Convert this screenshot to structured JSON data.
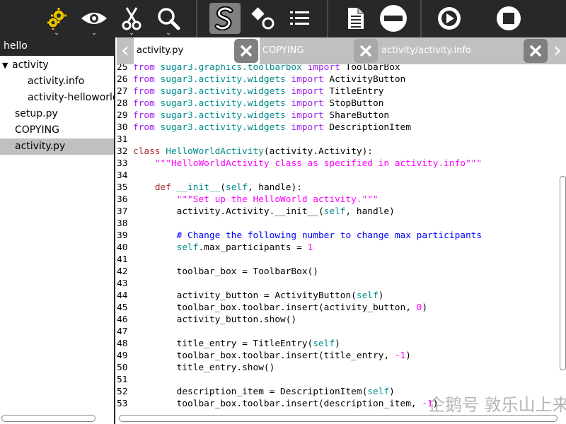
{
  "toolbar": {
    "buttons": [
      {
        "name": "activity-icon",
        "has_dropdown": true
      },
      {
        "name": "view-icon",
        "has_dropdown": true
      },
      {
        "name": "edit-scissors-icon",
        "has_dropdown": true
      },
      {
        "name": "search-icon",
        "has_dropdown": true
      },
      {
        "name": "symbol-s-icon",
        "active": true
      },
      {
        "name": "shapes-icon"
      },
      {
        "name": "list-icon"
      },
      {
        "name": "document-icon"
      },
      {
        "name": "minus-circle-icon"
      },
      {
        "name": "play-icon"
      },
      {
        "name": "stop-icon"
      }
    ],
    "dropdown_glyph": "⌄"
  },
  "sidebar": {
    "header": "hello",
    "items": [
      {
        "label": "activity",
        "expanded": true,
        "level": 0
      },
      {
        "label": "activity.info",
        "level": 1
      },
      {
        "label": "activity-helloworld",
        "level": 1
      },
      {
        "label": "setup.py",
        "level": 0
      },
      {
        "label": "COPYING",
        "level": 0
      },
      {
        "label": "activity.py",
        "level": 0,
        "selected": true
      }
    ]
  },
  "tabs": [
    {
      "label": "activity.py",
      "active": true
    },
    {
      "label": "COPYING",
      "active": false
    },
    {
      "label": "activity/activity.info",
      "active": false
    }
  ],
  "nav": {
    "prev": "‹",
    "next": "›"
  },
  "editor": {
    "lines": [
      {
        "n": "25",
        "t": [
          [
            "kw2",
            "from "
          ],
          [
            "mod",
            "sugar3.graphics.toolbarbox "
          ],
          [
            "kw2",
            "import "
          ],
          [
            "",
            "ToolbarBox"
          ]
        ]
      },
      {
        "n": "26",
        "t": [
          [
            "kw2",
            "from "
          ],
          [
            "mod",
            "sugar3.activity.widgets "
          ],
          [
            "kw2",
            "import "
          ],
          [
            "",
            "ActivityButton"
          ]
        ]
      },
      {
        "n": "27",
        "t": [
          [
            "kw2",
            "from "
          ],
          [
            "mod",
            "sugar3.activity.widgets "
          ],
          [
            "kw2",
            "import "
          ],
          [
            "",
            "TitleEntry"
          ]
        ]
      },
      {
        "n": "28",
        "t": [
          [
            "kw2",
            "from "
          ],
          [
            "mod",
            "sugar3.activity.widgets "
          ],
          [
            "kw2",
            "import "
          ],
          [
            "",
            "StopButton"
          ]
        ]
      },
      {
        "n": "29",
        "t": [
          [
            "kw2",
            "from "
          ],
          [
            "mod",
            "sugar3.activity.widgets "
          ],
          [
            "kw2",
            "import "
          ],
          [
            "",
            "ShareButton"
          ]
        ]
      },
      {
        "n": "30",
        "t": [
          [
            "kw2",
            "from "
          ],
          [
            "mod",
            "sugar3.activity.widgets "
          ],
          [
            "kw2",
            "import "
          ],
          [
            "",
            "DescriptionItem"
          ]
        ]
      },
      {
        "n": "31",
        "t": []
      },
      {
        "n": "32",
        "t": [
          [
            "kw",
            "class "
          ],
          [
            "cls",
            "HelloWorldActivity"
          ],
          [
            "",
            "(activity.Activity):"
          ]
        ]
      },
      {
        "n": "33",
        "t": [
          [
            "",
            "    "
          ],
          [
            "str",
            "\"\"\"HelloWorldActivity class as specified in activity.info\"\"\""
          ]
        ]
      },
      {
        "n": "34",
        "t": []
      },
      {
        "n": "35",
        "t": [
          [
            "",
            "    "
          ],
          [
            "kw",
            "def "
          ],
          [
            "cls",
            "__init__"
          ],
          [
            "",
            "("
          ],
          [
            "bltn",
            "self"
          ],
          [
            "",
            ", handle):"
          ]
        ]
      },
      {
        "n": "36",
        "t": [
          [
            "",
            "        "
          ],
          [
            "str",
            "\"\"\"Set up the HelloWorld activity.\"\"\""
          ]
        ]
      },
      {
        "n": "37",
        "t": [
          [
            "",
            "        activity.Activity.__init__("
          ],
          [
            "bltn",
            "self"
          ],
          [
            "",
            ", handle)"
          ]
        ]
      },
      {
        "n": "38",
        "t": []
      },
      {
        "n": "39",
        "t": [
          [
            "",
            "        "
          ],
          [
            "cmt",
            "# Change the following number to change max participants"
          ]
        ]
      },
      {
        "n": "40",
        "t": [
          [
            "",
            "        "
          ],
          [
            "bltn",
            "self"
          ],
          [
            "",
            ".max_participants = "
          ],
          [
            "num",
            "1"
          ]
        ]
      },
      {
        "n": "41",
        "t": []
      },
      {
        "n": "42",
        "t": [
          [
            "",
            "        toolbar_box = ToolbarBox()"
          ]
        ]
      },
      {
        "n": "43",
        "t": []
      },
      {
        "n": "44",
        "t": [
          [
            "",
            "        activity_button = ActivityButton("
          ],
          [
            "bltn",
            "self"
          ],
          [
            "",
            ")"
          ]
        ]
      },
      {
        "n": "45",
        "t": [
          [
            "",
            "        toolbar_box.toolbar.insert(activity_button, "
          ],
          [
            "num",
            "0"
          ],
          [
            "",
            ")"
          ]
        ]
      },
      {
        "n": "46",
        "t": [
          [
            "",
            "        activity_button.show()"
          ]
        ]
      },
      {
        "n": "47",
        "t": []
      },
      {
        "n": "48",
        "t": [
          [
            "",
            "        title_entry = TitleEntry("
          ],
          [
            "bltn",
            "self"
          ],
          [
            "",
            ")"
          ]
        ]
      },
      {
        "n": "49",
        "t": [
          [
            "",
            "        toolbar_box.toolbar.insert(title_entry, "
          ],
          [
            "num",
            "-1"
          ],
          [
            "",
            ")"
          ]
        ]
      },
      {
        "n": "50",
        "t": [
          [
            "",
            "        title_entry.show()"
          ]
        ]
      },
      {
        "n": "51",
        "t": []
      },
      {
        "n": "52",
        "t": [
          [
            "",
            "        description_item = DescriptionItem("
          ],
          [
            "bltn",
            "self"
          ],
          [
            "",
            ")"
          ]
        ]
      },
      {
        "n": "53",
        "t": [
          [
            "",
            "        toolbar_box.toolbar.insert(description_item, "
          ],
          [
            "num",
            "-1"
          ],
          [
            "",
            ")"
          ]
        ]
      }
    ]
  },
  "watermark": "企鹅号 敦乐山上来的极客",
  "colors": {
    "toolbar_bg": "#282828",
    "activity_icon": "#e8c000"
  }
}
